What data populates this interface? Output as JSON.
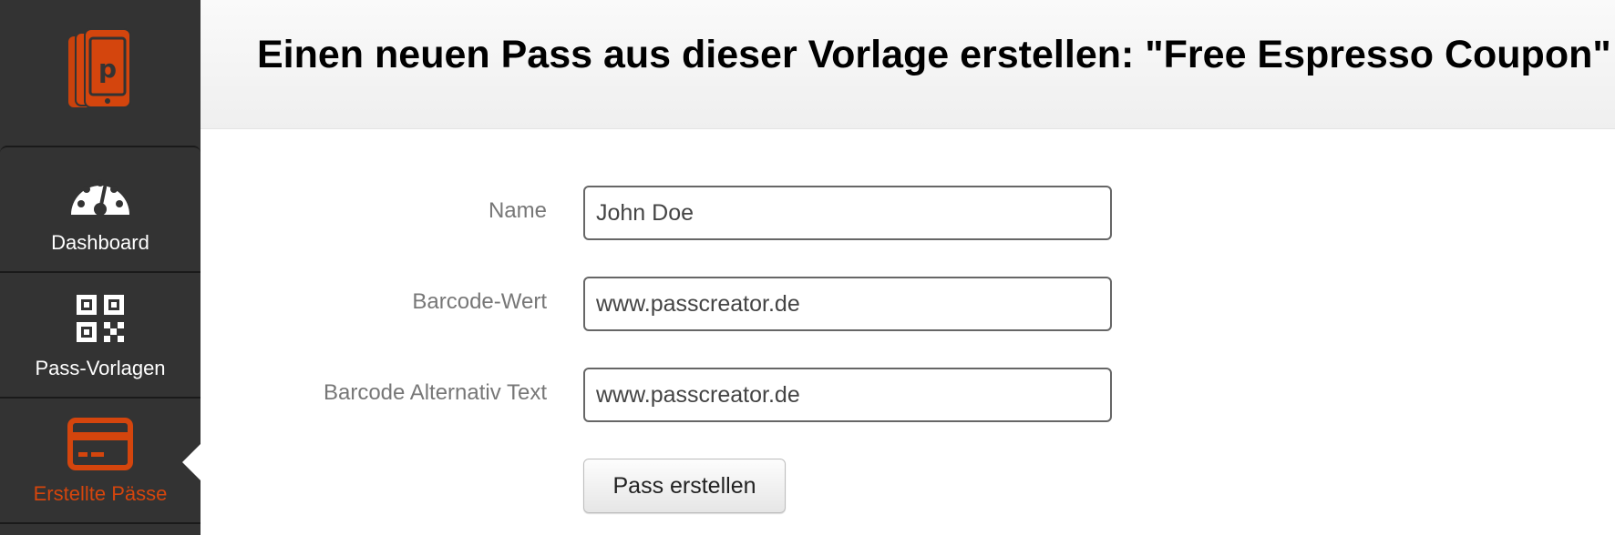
{
  "colors": {
    "sidebar_bg": "#333333",
    "accent": "#d4450d",
    "header_bg": "#f4f4f4"
  },
  "sidebar": {
    "logo_icon": "passcreator-logo-icon",
    "items": [
      {
        "label": "Dashboard",
        "icon": "gauge-icon",
        "active": false
      },
      {
        "label": "Pass-Vorlagen",
        "icon": "qr-code-icon",
        "active": false
      },
      {
        "label": "Erstellte Pässe",
        "icon": "credit-card-icon",
        "active": true
      }
    ]
  },
  "header": {
    "title": "Einen neuen Pass aus dieser Vorlage erstellen: \"Free Espresso Coupon\""
  },
  "form": {
    "fields": [
      {
        "label": "Name",
        "value": "John Doe"
      },
      {
        "label": "Barcode-Wert",
        "value": "www.passcreator.de"
      },
      {
        "label": "Barcode Alternativ Text",
        "value": "www.passcreator.de"
      }
    ],
    "submit_label": "Pass erstellen"
  }
}
